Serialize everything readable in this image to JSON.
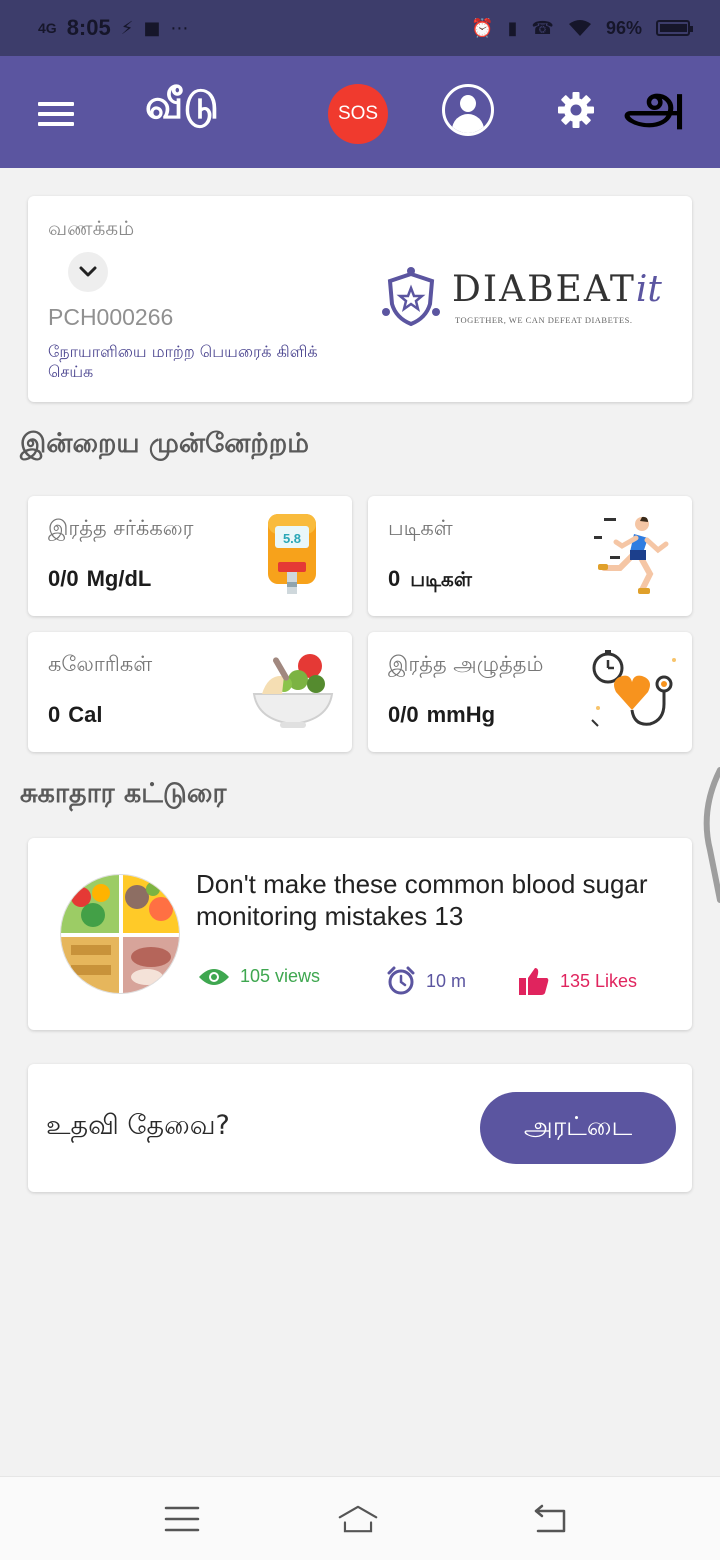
{
  "status_bar": {
    "network": "4G",
    "time": "8:05",
    "battery_percent": "96%",
    "icons": [
      "signal-icon",
      "usb-icon",
      "video-icon",
      "more-dots-icon",
      "alarm-icon",
      "vibrate-icon",
      "wifi-calling-icon",
      "wifi-icon",
      "battery-icon"
    ]
  },
  "app_bar": {
    "title": "வீடு",
    "sos_label": "SOS",
    "language_label": "அ",
    "color": "#5b55a0"
  },
  "greeting": {
    "label": "வணக்கம்",
    "patient_id": "PCH000266",
    "change_patient_text": "நோயாளியை மாற்ற பெயரைக் கிளிக் செய்க",
    "logo": {
      "brand": "DIABEAT",
      "brand_suffix": "it",
      "tagline": "TOGETHER, WE CAN DEFEAT DIABETES."
    }
  },
  "progress": {
    "title": "இன்றைய முன்னேற்றம்",
    "blood_sugar": {
      "label": "இரத்த சர்க்கரை",
      "value": "0/0",
      "unit": "Mg/dL",
      "meter_reading": "5.8"
    },
    "steps": {
      "label": "படிகள்",
      "value": "0",
      "unit": "படிகள்"
    },
    "calories": {
      "label": "கலோரிகள்",
      "value": "0",
      "unit": "Cal"
    },
    "blood_pressure": {
      "label": "இரத்த அழுத்தம்",
      "value": "0/0",
      "unit": "mmHg"
    }
  },
  "articles": {
    "title": "சுகாதார கட்டுரை",
    "items": [
      {
        "title": "Don't make these common blood sugar monitoring mistakes 13",
        "views": "105 views",
        "read_time": "10 m",
        "likes": "135 Likes"
      }
    ]
  },
  "help": {
    "text": "உதவி தேவை?",
    "chat_label": "அரட்டை"
  },
  "colors": {
    "primary": "#5b55a0",
    "sos": "#f03a2e",
    "views": "#3fa750",
    "likes": "#e0245e"
  }
}
